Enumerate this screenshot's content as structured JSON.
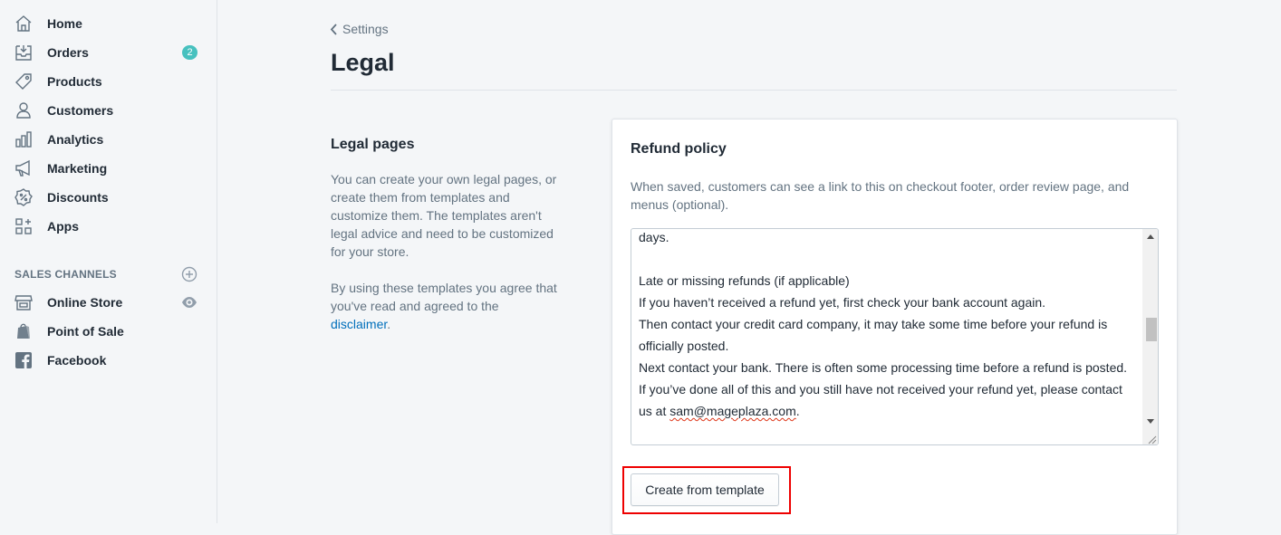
{
  "sidebar": {
    "items": [
      {
        "label": "Home",
        "icon": "home-icon"
      },
      {
        "label": "Orders",
        "icon": "orders-icon",
        "badge": "2"
      },
      {
        "label": "Products",
        "icon": "tag-icon"
      },
      {
        "label": "Customers",
        "icon": "person-icon"
      },
      {
        "label": "Analytics",
        "icon": "bar-chart-icon"
      },
      {
        "label": "Marketing",
        "icon": "megaphone-icon"
      },
      {
        "label": "Discounts",
        "icon": "discount-icon"
      },
      {
        "label": "Apps",
        "icon": "apps-icon"
      }
    ],
    "sales_channels_heading": "SALES CHANNELS",
    "channels": [
      {
        "label": "Online Store",
        "icon": "store-icon"
      },
      {
        "label": "Point of Sale",
        "icon": "shopify-bag-icon"
      },
      {
        "label": "Facebook",
        "icon": "facebook-icon"
      }
    ]
  },
  "header": {
    "breadcrumb": "Settings",
    "title": "Legal"
  },
  "legal_pages": {
    "title": "Legal pages",
    "desc1": "You can create your own legal pages, or create them from templates and customize them. The templates aren't legal advice and need to be customized for your store.",
    "desc2_prefix": "By using these templates you agree that you've read and agreed to the ",
    "desc2_link": "disclaimer",
    "desc2_suffix": "."
  },
  "refund_policy": {
    "title": "Refund policy",
    "help": "When saved, customers can see a link to this on checkout footer, order review page, and menus (optional).",
    "text_lines": [
      "days.",
      "",
      "Late or missing refunds (if applicable)",
      "If you haven’t received a refund yet, first check your bank account again.",
      "Then contact your credit card company, it may take some time before your refund is",
      "officially posted.",
      "Next contact your bank. There is often some processing time before a refund is posted.",
      "If you’ve done all of this and you still have not received your refund yet, please contact"
    ],
    "last_line_prefix": "us at ",
    "last_line_email": "sam@mageplaza.com",
    "last_line_suffix": ".",
    "button_label": "Create from template"
  },
  "colors": {
    "accent_badge": "#47c1bf",
    "link": "#006fbb",
    "highlight": "#ee0000"
  }
}
